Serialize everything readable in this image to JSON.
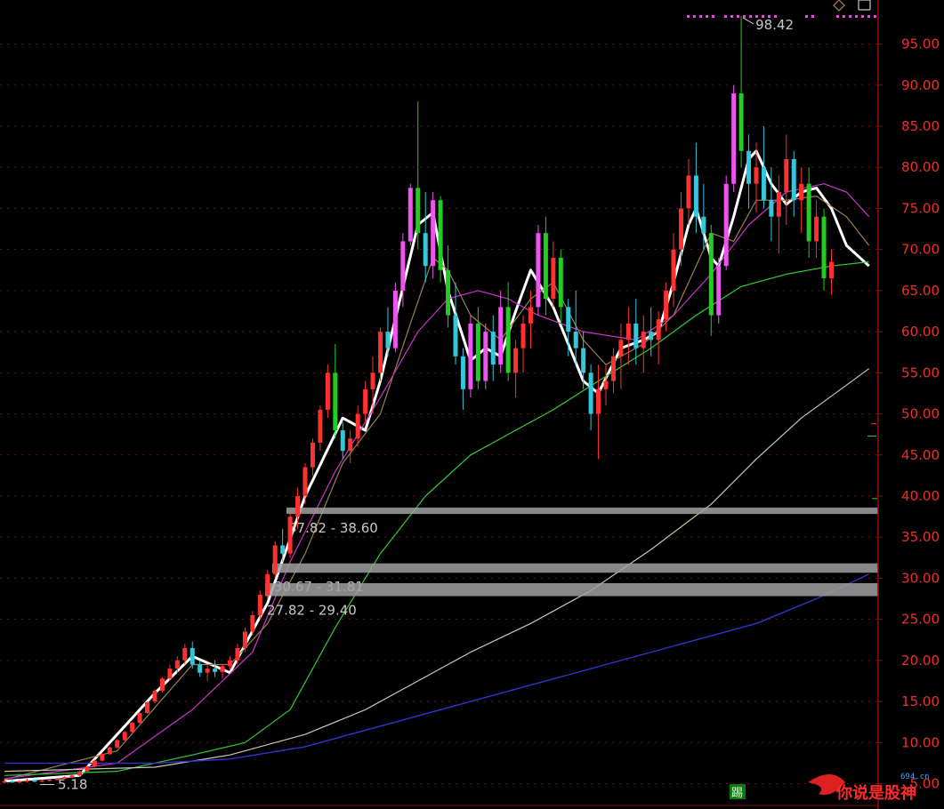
{
  "chart_data": {
    "type": "candlestick",
    "ylim": [
      3.0,
      99.5
    ],
    "y_ticks": [
      "5.00",
      "10.00",
      "15.00",
      "20.00",
      "25.00",
      "30.00",
      "35.00",
      "40.00",
      "45.00",
      "50.00",
      "55.00",
      "60.00",
      "65.00",
      "70.00",
      "75.00",
      "80.00",
      "85.00",
      "90.00",
      "95.00"
    ],
    "grid": "horizontal dashed",
    "annotations": {
      "high": "98.42",
      "low": "5.18"
    },
    "zones": [
      {
        "label": "37.82 - 38.60",
        "low": 37.82,
        "high": 38.6
      },
      {
        "label": "30.67 - 31.81",
        "low": 30.67,
        "high": 31.81
      },
      {
        "label": "27.82 - 29.40",
        "low": 27.82,
        "high": 29.4
      }
    ],
    "colors": {
      "background": "#000000",
      "axis": "#8a0f0f",
      "tick": "#e8312c",
      "up": "#ff3030",
      "down": "#33c7d9",
      "up_strong": "#ee55ee",
      "down_strong": "#22cc22",
      "ma_short": "#ffffff",
      "ma_mid": "#9a8050",
      "ma_mid2": "#cc33cc",
      "ma_long": "#33cc33",
      "ma_longer": "#c8c8b0",
      "ma_longest": "#3333cc",
      "zone": "#a0a0a0"
    },
    "candles": [
      [
        5.2,
        5.6,
        5.0,
        5.3
      ],
      [
        5.3,
        5.5,
        5.1,
        5.2
      ],
      [
        5.2,
        5.4,
        5.0,
        5.3
      ],
      [
        5.3,
        5.6,
        5.1,
        5.4
      ],
      [
        5.4,
        5.5,
        5.18,
        5.3
      ],
      [
        5.3,
        5.5,
        5.2,
        5.4
      ],
      [
        5.4,
        5.6,
        5.3,
        5.5
      ],
      [
        5.5,
        5.7,
        5.4,
        5.6
      ],
      [
        5.6,
        5.9,
        5.5,
        5.8
      ],
      [
        5.8,
        6.1,
        5.7,
        6.0
      ],
      [
        6.0,
        6.6,
        5.9,
        6.5
      ],
      [
        6.5,
        7.2,
        6.4,
        7.1
      ],
      [
        7.1,
        7.9,
        7.0,
        7.8
      ],
      [
        7.8,
        8.7,
        7.7,
        8.6
      ],
      [
        8.6,
        9.5,
        8.5,
        9.4
      ],
      [
        9.4,
        10.4,
        9.3,
        10.3
      ],
      [
        10.3,
        11.4,
        10.2,
        11.3
      ],
      [
        11.3,
        12.5,
        11.2,
        12.4
      ],
      [
        12.4,
        13.7,
        12.3,
        13.6
      ],
      [
        13.6,
        15.0,
        13.5,
        14.9
      ],
      [
        15.0,
        16.5,
        14.8,
        16.3
      ],
      [
        16.3,
        18.0,
        16.1,
        17.8
      ],
      [
        17.8,
        19.5,
        17.5,
        19.0
      ],
      [
        19.0,
        20.5,
        18.5,
        20.0
      ],
      [
        20.0,
        22.0,
        19.5,
        21.5
      ],
      [
        21.5,
        22.3,
        19.0,
        19.5
      ],
      [
        19.5,
        20.0,
        18.0,
        18.5
      ],
      [
        18.5,
        19.5,
        17.5,
        19.0
      ],
      [
        19.0,
        20.0,
        18.0,
        18.6
      ],
      [
        18.6,
        19.5,
        17.8,
        19.3
      ],
      [
        19.3,
        20.5,
        18.8,
        20.0
      ],
      [
        20.0,
        22.0,
        19.5,
        21.5
      ],
      [
        21.5,
        24.0,
        21.0,
        23.5
      ],
      [
        23.5,
        26.0,
        23.0,
        25.5
      ],
      [
        25.5,
        28.5,
        25.0,
        28.0
      ],
      [
        28.0,
        31.0,
        27.5,
        30.5
      ],
      [
        30.5,
        34.5,
        30.0,
        34.0
      ],
      [
        34.0,
        36.0,
        32.0,
        33.0
      ],
      [
        33.0,
        38.0,
        32.5,
        37.5
      ],
      [
        37.5,
        41.0,
        36.0,
        40.0
      ],
      [
        40.0,
        44.0,
        39.0,
        43.5
      ],
      [
        43.5,
        47.0,
        42.5,
        46.5
      ],
      [
        46.5,
        51.0,
        45.5,
        50.5
      ],
      [
        50.5,
        56.0,
        49.5,
        55.0
      ],
      [
        55.0,
        58.5,
        47.0,
        48.0
      ],
      [
        48.0,
        49.0,
        44.5,
        45.5
      ],
      [
        45.5,
        48.0,
        44.0,
        47.0
      ],
      [
        47.0,
        51.0,
        46.0,
        50.0
      ],
      [
        50.0,
        54.0,
        49.0,
        53.0
      ],
      [
        53.0,
        57.0,
        50.0,
        55.0
      ],
      [
        55.0,
        60.5,
        54.0,
        60.0
      ],
      [
        60.0,
        63.0,
        57.0,
        58.0
      ],
      [
        58.0,
        66.0,
        57.5,
        65.0
      ],
      [
        65.0,
        72.0,
        63.0,
        71.0
      ],
      [
        71.0,
        78.0,
        70.5,
        77.5
      ],
      [
        77.5,
        88.0,
        70.0,
        72.0
      ],
      [
        72.0,
        77.0,
        66.0,
        68.0
      ],
      [
        68.0,
        77.0,
        66.5,
        76.0
      ],
      [
        76.0,
        76.5,
        66.0,
        67.5
      ],
      [
        67.5,
        70.5,
        60.5,
        62.0
      ],
      [
        62.0,
        66.0,
        56.0,
        57.0
      ],
      [
        57.0,
        58.0,
        50.5,
        53.0
      ],
      [
        53.0,
        62.0,
        52.0,
        61.0
      ],
      [
        61.0,
        63.0,
        53.0,
        54.0
      ],
      [
        54.0,
        61.0,
        53.0,
        60.0
      ],
      [
        60.0,
        62.0,
        54.0,
        56.0
      ],
      [
        56.0,
        65.0,
        55.0,
        63.0
      ],
      [
        63.0,
        66.0,
        54.0,
        55.0
      ],
      [
        55.0,
        59.0,
        52.0,
        58.0
      ],
      [
        58.0,
        62.0,
        55.0,
        61.0
      ],
      [
        61.0,
        65.0,
        58.0,
        63.0
      ],
      [
        63.0,
        73.0,
        62.0,
        72.0
      ],
      [
        72.0,
        74.0,
        62.0,
        64.0
      ],
      [
        64.0,
        71.0,
        63.0,
        69.0
      ],
      [
        69.0,
        70.0,
        61.0,
        63.0
      ],
      [
        63.0,
        64.0,
        57.0,
        60.0
      ],
      [
        60.0,
        65.0,
        56.0,
        58.0
      ],
      [
        58.0,
        60.0,
        53.0,
        55.0
      ],
      [
        55.0,
        56.0,
        48.0,
        50.0
      ],
      [
        50.0,
        56.0,
        44.5,
        53.0
      ],
      [
        53.0,
        56.0,
        51.0,
        54.0
      ],
      [
        54.0,
        58.0,
        52.5,
        57.0
      ],
      [
        57.0,
        61.0,
        53.0,
        59.0
      ],
      [
        59.0,
        63.0,
        56.0,
        61.0
      ],
      [
        61.0,
        64.0,
        56.0,
        58.0
      ],
      [
        58.0,
        62.0,
        55.0,
        60.0
      ],
      [
        60.0,
        63.0,
        57.0,
        59.0
      ],
      [
        59.0,
        62.5,
        56.0,
        61.5
      ],
      [
        61.5,
        66.0,
        60.0,
        65.0
      ],
      [
        65.0,
        72.0,
        63.0,
        70.0
      ],
      [
        70.0,
        77.0,
        68.0,
        75.0
      ],
      [
        75.0,
        81.0,
        73.0,
        79.0
      ],
      [
        79.0,
        83.0,
        72.0,
        74.0
      ],
      [
        74.0,
        78.0,
        70.0,
        72.0
      ],
      [
        72.0,
        73.0,
        59.5,
        62.0
      ],
      [
        62.0,
        69.0,
        61.0,
        68.0
      ],
      [
        68.0,
        79.0,
        67.5,
        78.0
      ],
      [
        78.0,
        90.0,
        77.0,
        89.0
      ],
      [
        89.0,
        98.42,
        80.0,
        82.0
      ],
      [
        82.0,
        84.0,
        75.0,
        78.0
      ],
      [
        78.0,
        83.0,
        74.5,
        80.0
      ],
      [
        80.0,
        85.0,
        75.0,
        76.0
      ],
      [
        76.0,
        80.0,
        71.0,
        74.0
      ],
      [
        74.0,
        79.0,
        69.5,
        77.0
      ],
      [
        77.0,
        84.0,
        73.0,
        81.0
      ],
      [
        81.0,
        82.0,
        74.0,
        76.0
      ],
      [
        76.0,
        80.0,
        72.0,
        78.0
      ],
      [
        78.0,
        80.0,
        69.0,
        71.0
      ],
      [
        71.0,
        76.0,
        69.0,
        74.0
      ],
      [
        74.0,
        75.0,
        65.0,
        66.5
      ],
      [
        66.5,
        70.0,
        64.5,
        68.5
      ]
    ],
    "moving_averages": {
      "ma_short": [
        [
          0,
          5.3
        ],
        [
          10,
          6.0
        ],
        [
          20,
          16.0
        ],
        [
          25,
          20.5
        ],
        [
          30,
          18.5
        ],
        [
          35,
          27.0
        ],
        [
          40,
          40.0
        ],
        [
          45,
          49.5
        ],
        [
          48,
          48.0
        ],
        [
          50,
          54.0
        ],
        [
          55,
          73.0
        ],
        [
          57,
          74.5
        ],
        [
          59,
          65.0
        ],
        [
          62,
          56.5
        ],
        [
          64,
          58.0
        ],
        [
          66,
          57.0
        ],
        [
          68,
          62.5
        ],
        [
          70,
          67.5
        ],
        [
          73,
          63.0
        ],
        [
          77,
          54.0
        ],
        [
          79,
          52.5
        ],
        [
          82,
          58.0
        ],
        [
          85,
          59.0
        ],
        [
          87,
          60.0
        ],
        [
          89,
          66.0
        ],
        [
          91,
          73.0
        ],
        [
          92,
          75.0
        ],
        [
          94,
          69.0
        ],
        [
          95,
          68.0
        ],
        [
          97,
          74.0
        ],
        [
          99,
          81.0
        ],
        [
          100,
          82.0
        ],
        [
          102,
          78.0
        ],
        [
          104,
          75.5
        ],
        [
          106,
          77.0
        ],
        [
          108,
          77.5
        ],
        [
          110,
          75.0
        ],
        [
          112,
          70.5
        ],
        [
          115,
          68.0
        ]
      ],
      "ma_mid": [
        [
          0,
          5.5
        ],
        [
          15,
          9.0
        ],
        [
          25,
          19.5
        ],
        [
          30,
          19.5
        ],
        [
          35,
          24.5
        ],
        [
          40,
          33.0
        ],
        [
          45,
          44.0
        ],
        [
          50,
          50.0
        ],
        [
          54,
          61.0
        ],
        [
          57,
          69.0
        ],
        [
          59,
          67.5
        ],
        [
          62,
          62.0
        ],
        [
          66,
          59.0
        ],
        [
          70,
          64.0
        ],
        [
          73,
          66.0
        ],
        [
          77,
          59.0
        ],
        [
          80,
          56.0
        ],
        [
          85,
          58.5
        ],
        [
          89,
          62.0
        ],
        [
          94,
          72.0
        ],
        [
          97,
          71.0
        ],
        [
          100,
          76.0
        ],
        [
          104,
          76.0
        ],
        [
          108,
          76.5
        ],
        [
          112,
          74.0
        ],
        [
          115,
          70.5
        ]
      ],
      "ma_mid2": [
        [
          0,
          5.6
        ],
        [
          15,
          7.5
        ],
        [
          25,
          14.0
        ],
        [
          33,
          21.0
        ],
        [
          38,
          32.0
        ],
        [
          44,
          43.0
        ],
        [
          50,
          52.0
        ],
        [
          55,
          60.0
        ],
        [
          59,
          64.0
        ],
        [
          63,
          65.0
        ],
        [
          67,
          64.0
        ],
        [
          71,
          62.0
        ],
        [
          77,
          60.0
        ],
        [
          84,
          59.0
        ],
        [
          89,
          62.0
        ],
        [
          94,
          67.0
        ],
        [
          99,
          73.0
        ],
        [
          104,
          77.0
        ],
        [
          109,
          78.0
        ],
        [
          112,
          77.0
        ],
        [
          115,
          74.0
        ]
      ],
      "ma_long": [
        [
          0,
          6.0
        ],
        [
          15,
          6.5
        ],
        [
          25,
          8.5
        ],
        [
          32,
          10.0
        ],
        [
          38,
          14.0
        ],
        [
          44,
          24.0
        ],
        [
          50,
          33.0
        ],
        [
          56,
          40.0
        ],
        [
          62,
          45.0
        ],
        [
          68,
          48.0
        ],
        [
          73,
          50.5
        ],
        [
          79,
          54.0
        ],
        [
          86,
          58.0
        ],
        [
          92,
          62.0
        ],
        [
          98,
          65.5
        ],
        [
          104,
          67.0
        ],
        [
          110,
          68.0
        ],
        [
          115,
          68.5
        ]
      ],
      "ma_longer": [
        [
          0,
          6.5
        ],
        [
          20,
          7.0
        ],
        [
          30,
          8.5
        ],
        [
          40,
          11.0
        ],
        [
          48,
          14.0
        ],
        [
          55,
          17.5
        ],
        [
          62,
          21.0
        ],
        [
          70,
          24.5
        ],
        [
          78,
          28.5
        ],
        [
          86,
          33.5
        ],
        [
          94,
          39.0
        ],
        [
          100,
          44.5
        ],
        [
          106,
          49.5
        ],
        [
          112,
          53.5
        ],
        [
          115,
          55.5
        ]
      ],
      "ma_longest": [
        [
          0,
          7.5
        ],
        [
          20,
          7.5
        ],
        [
          30,
          8.0
        ],
        [
          40,
          9.5
        ],
        [
          50,
          12.0
        ],
        [
          60,
          14.5
        ],
        [
          70,
          17.0
        ],
        [
          80,
          19.5
        ],
        [
          90,
          22.0
        ],
        [
          100,
          24.5
        ],
        [
          108,
          27.5
        ],
        [
          115,
          30.5
        ]
      ]
    }
  },
  "watermark": {
    "brand": "你说是股神",
    "site": "694.cn"
  },
  "corner_icons": {
    "diamond": "diamond-icon",
    "window": "window-icon"
  },
  "footer_badge": {
    "label": "踢"
  }
}
